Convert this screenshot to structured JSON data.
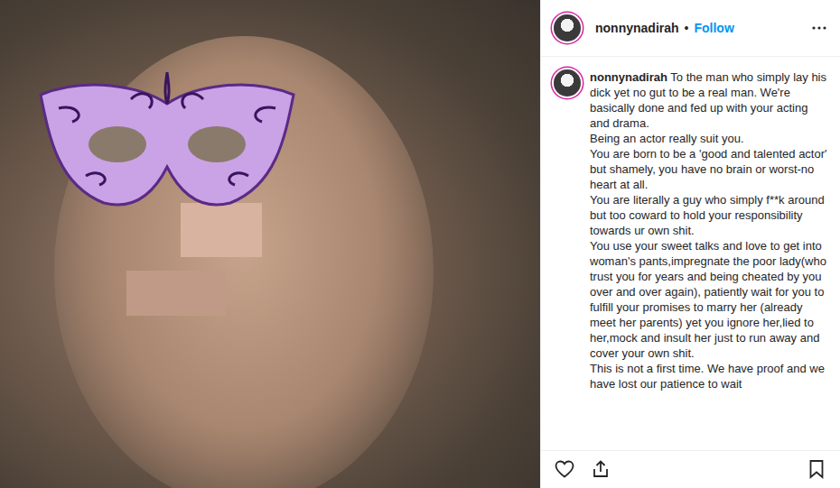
{
  "post": {
    "photo": {
      "kind": "blurred-portrait"
    },
    "header": {
      "username": "nonnynadirah",
      "separator": "•",
      "follow": "Follow"
    },
    "caption": {
      "username": "nonnynadirah",
      "text": "To the man who simply lay his dick yet no gut to be a real man. We're basically done and fed up with your acting and drama.\nBeing an actor really suit you.\nYou are born to be a 'good and talented actor' but shamely, you have no brain or worst-no heart at all.\nYou are literally a guy who simply f**k around but too coward to hold your responsibility towards ur own shit.\nYou use your sweet talks and love to get into woman's pants,impregnate the poor lady(who trust you for years and being cheated by you over and over again), patiently wait for you to fulfill your promises to marry her (already meet her parents) yet you ignore her,lied to her,mock and insult her just to run away and cover your own shit.\nThis is not a first time. We have proof and we have lost our patience to wait"
    }
  }
}
